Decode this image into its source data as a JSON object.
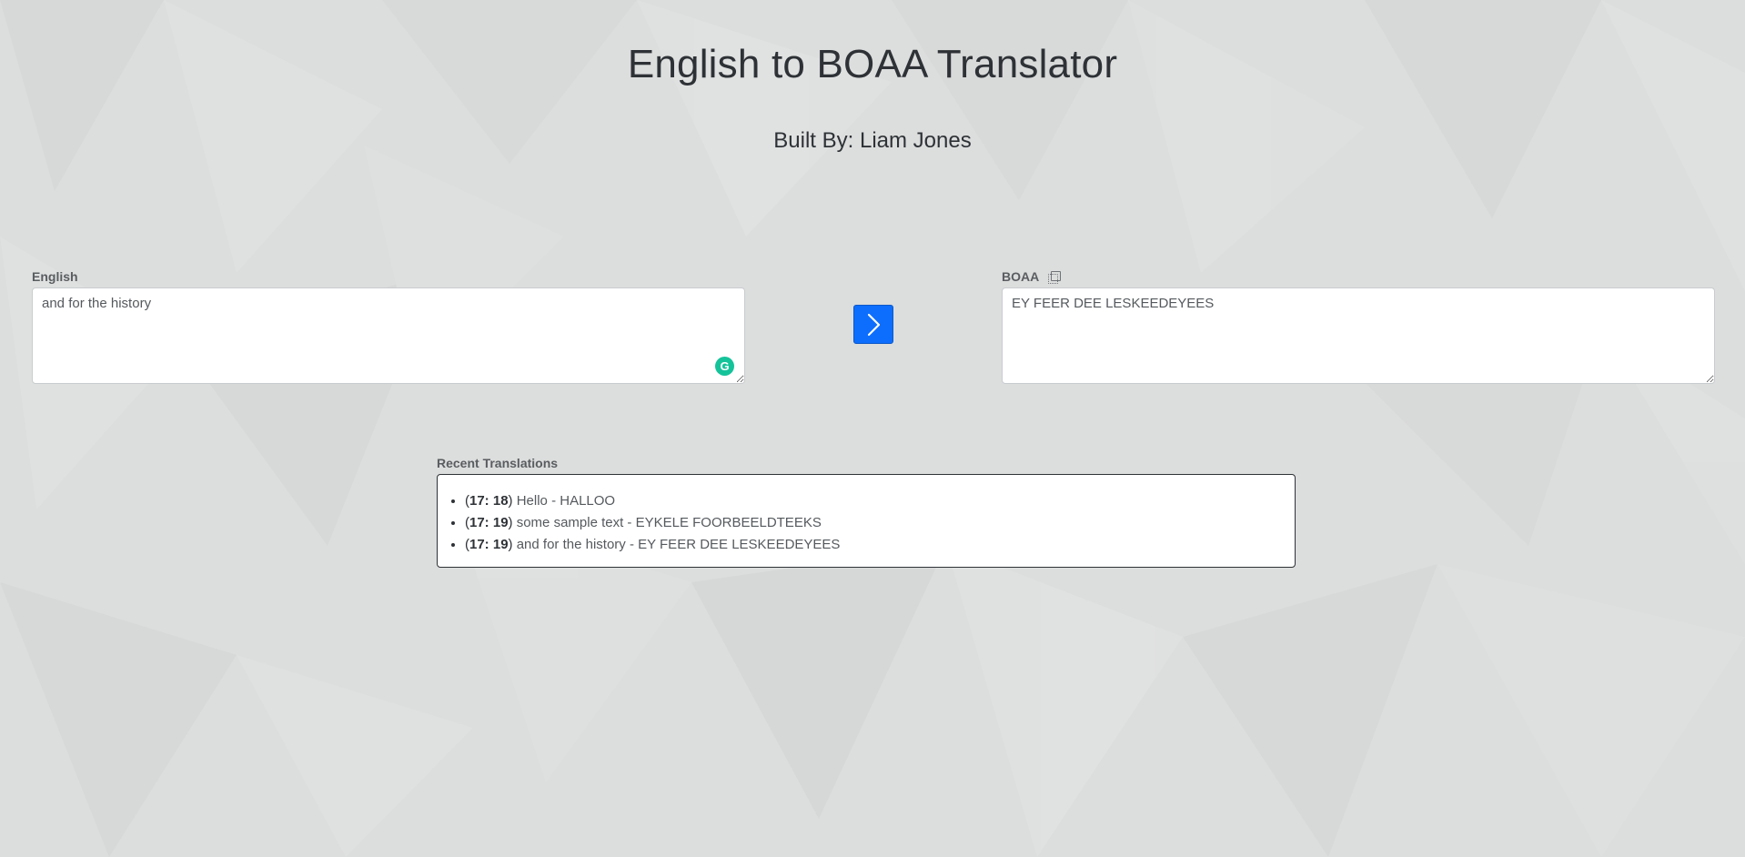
{
  "header": {
    "title": "English to BOAA Translator",
    "subtitle": "Built By: Liam Jones"
  },
  "english": {
    "label": "English",
    "value": "and for the history"
  },
  "boaa": {
    "label": "BOAA",
    "value": "EY FEER DEE LESKEEDEYEES",
    "copy_icon": "copy-icon"
  },
  "translate_button": {
    "icon": "chevron-right-icon",
    "color": "#0d6efd"
  },
  "grammarly": {
    "icon": "grammarly-icon",
    "glyph": "G",
    "color": "#15c39a"
  },
  "recent": {
    "label": "Recent Translations",
    "items": [
      {
        "time": "17: 18",
        "text": "Hello - HALLOO"
      },
      {
        "time": "17: 19",
        "text": "some sample text - EYKELE FOORBEELDTEEKS"
      },
      {
        "time": "17: 19",
        "text": "and for the history - EY FEER DEE LESKEEDEYEES"
      }
    ]
  }
}
